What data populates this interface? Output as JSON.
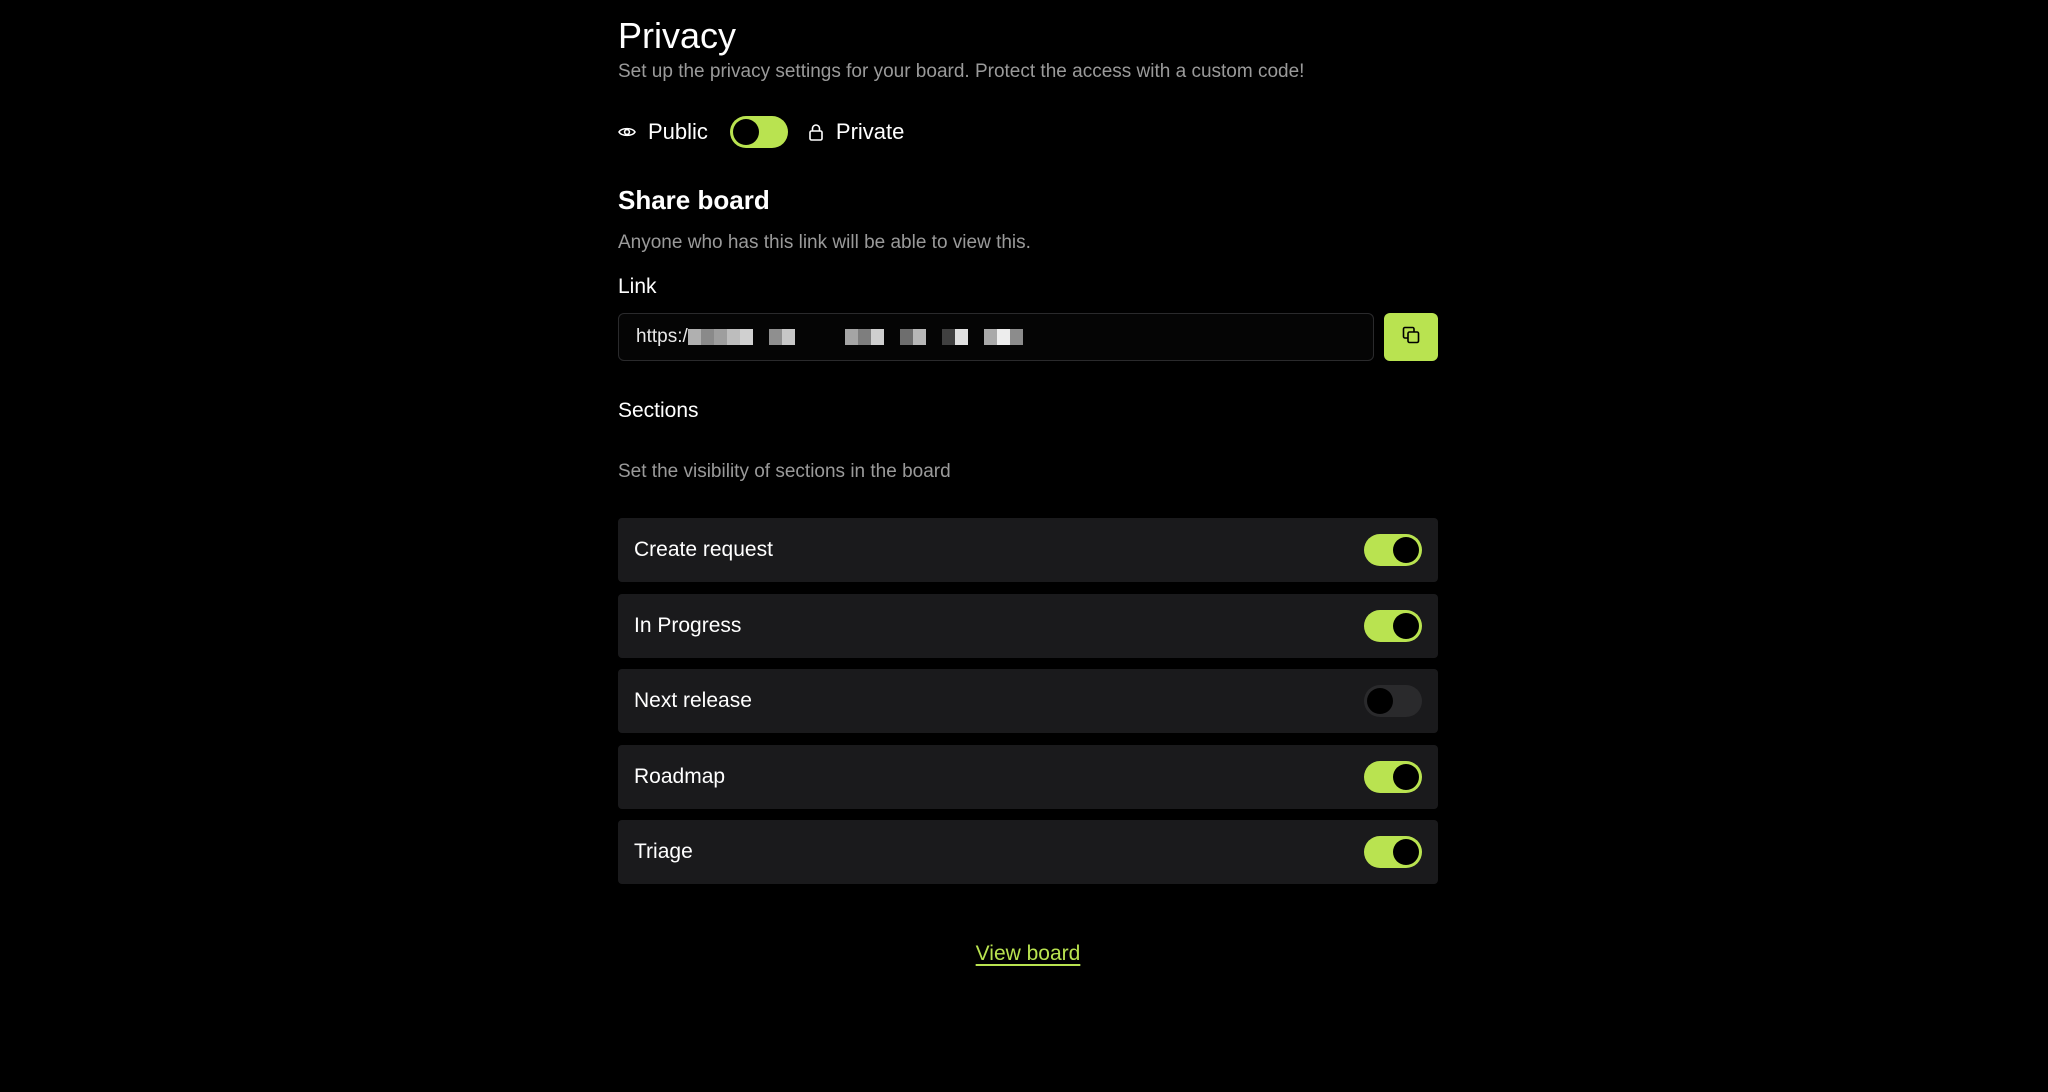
{
  "privacy": {
    "title": "Privacy",
    "subtitle": "Set up the privacy settings for your board. Protect the access with a custom code!",
    "public_label": "Public",
    "private_label": "Private",
    "public_icon": "eye-icon",
    "private_icon": "lock-icon",
    "is_private": false
  },
  "share": {
    "title": "Share board",
    "description": "Anyone who has this link will be able to view this.",
    "link_label": "Link",
    "link_prefix": "https:/",
    "copy_icon": "copy-icon"
  },
  "sections": {
    "title": "Sections",
    "description": "Set the visibility of sections in the board",
    "items": [
      {
        "label": "Create request",
        "enabled": true
      },
      {
        "label": "In Progress",
        "enabled": true
      },
      {
        "label": "Next release",
        "enabled": false
      },
      {
        "label": "Roadmap",
        "enabled": true
      },
      {
        "label": "Triage",
        "enabled": true
      }
    ]
  },
  "footer": {
    "view_board_label": "View board"
  },
  "colors": {
    "accent": "#b9e350",
    "background": "#000000",
    "row_background": "#1a1a1c",
    "muted_text": "#9a9a9a",
    "toggle_off": "#2a2a2c"
  }
}
